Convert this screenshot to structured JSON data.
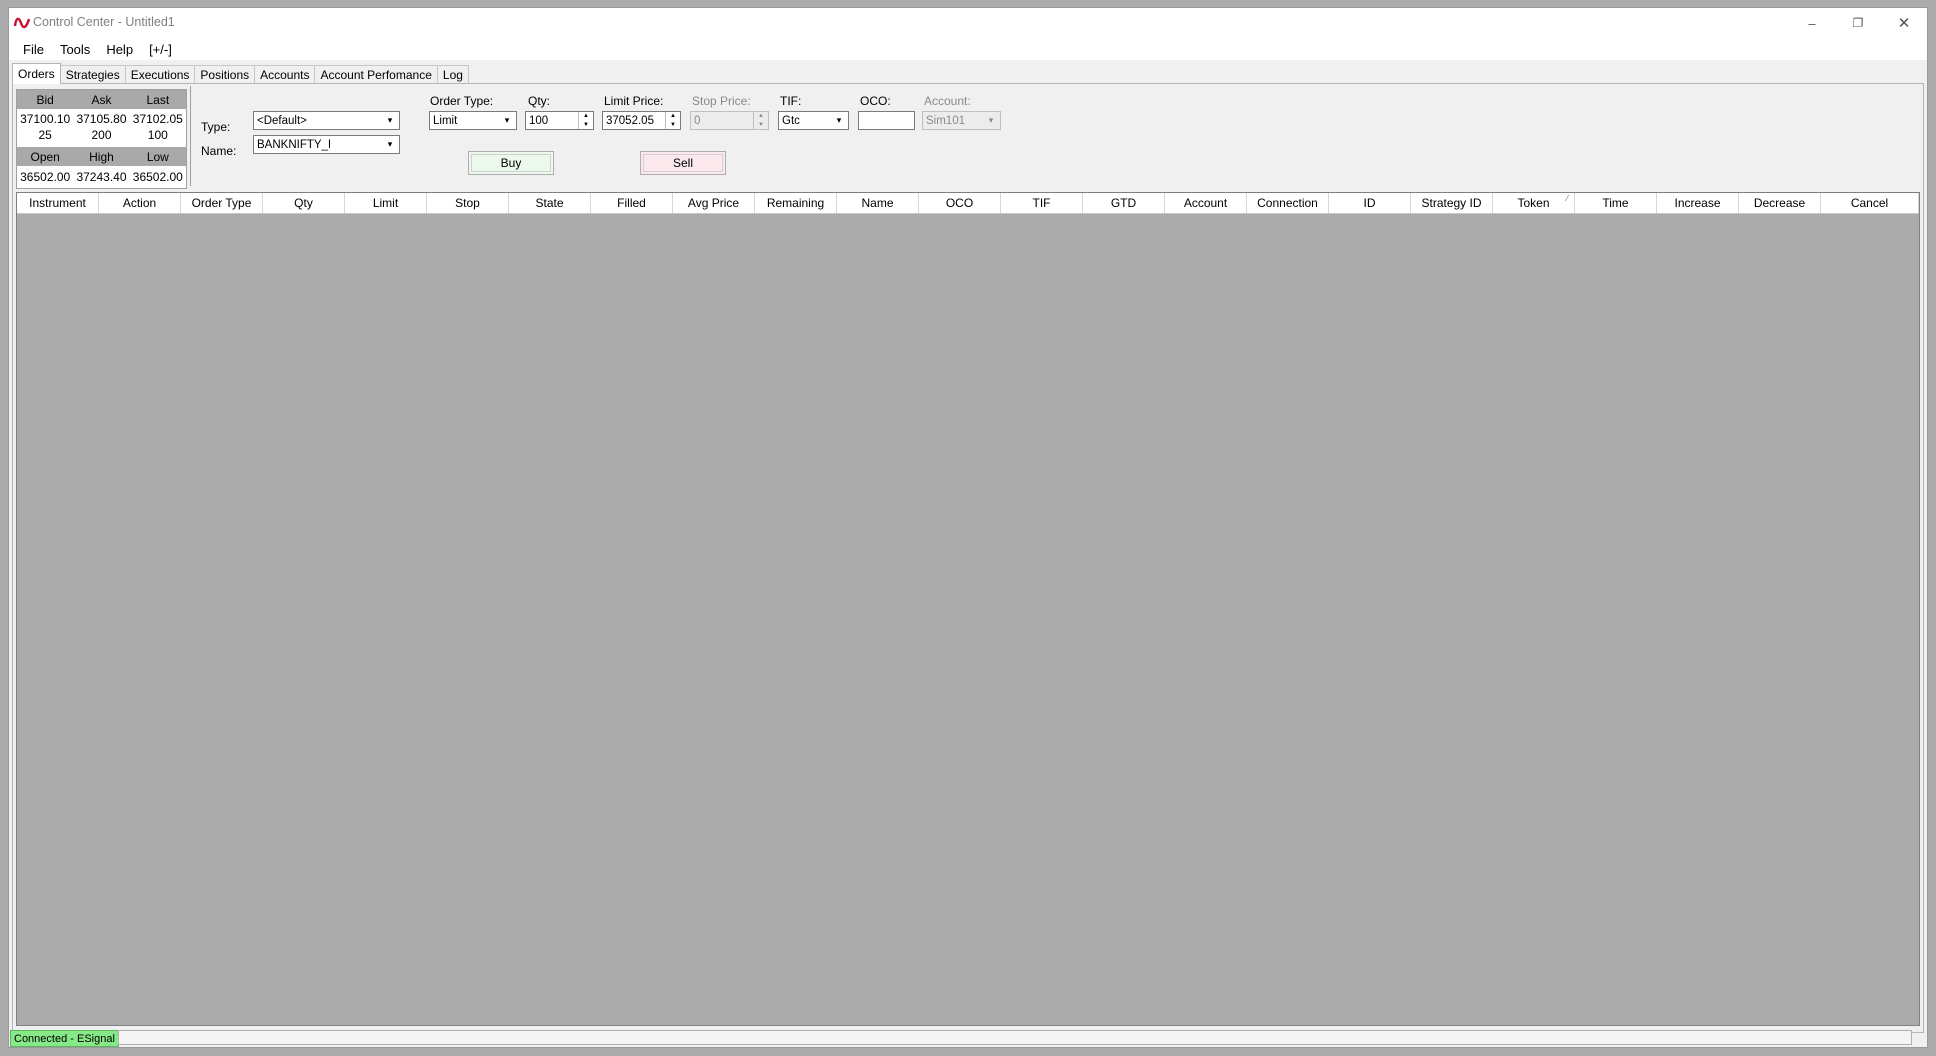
{
  "window": {
    "title": "Control Center - Untitled1",
    "controls": {
      "minimize": "–",
      "restore": "❐",
      "close": "✕"
    }
  },
  "menu": [
    "File",
    "Tools",
    "Help",
    "[+/-]"
  ],
  "tabs": [
    "Orders",
    "Strategies",
    "Executions",
    "Positions",
    "Accounts",
    "Account Perfomance",
    "Log"
  ],
  "quote": {
    "headers1": [
      "Bid",
      "Ask",
      "Last"
    ],
    "prices": [
      "37100.10",
      "37105.80",
      "37102.05"
    ],
    "sizes": [
      "25",
      "200",
      "100"
    ],
    "headers2": [
      "Open",
      "High",
      "Low"
    ],
    "ohl": [
      "36502.00",
      "37243.40",
      "36502.00"
    ]
  },
  "entry": {
    "type_label": "Type:",
    "type_value": "<Default>",
    "name_label": "Name:",
    "name_value": "BANKNIFTY_I",
    "order_type_label": "Order Type:",
    "order_type_value": "Limit",
    "qty_label": "Qty:",
    "qty_value": "100",
    "limit_label": "Limit Price:",
    "limit_value": "37052.05",
    "stop_label": "Stop Price:",
    "stop_value": "0",
    "tif_label": "TIF:",
    "tif_value": "Gtc",
    "oco_label": "OCO:",
    "oco_value": "",
    "account_label": "Account:",
    "account_value": "Sim101",
    "buy_label": "Buy",
    "sell_label": "Sell",
    "buy_color": "#eef9ee",
    "sell_color": "#fbe9ee"
  },
  "grid": {
    "columns": [
      "Instrument",
      "Action",
      "Order Type",
      "Qty",
      "Limit",
      "Stop",
      "State",
      "Filled",
      "Avg Price",
      "Remaining",
      "Name",
      "OCO",
      "TIF",
      "GTD",
      "Account",
      "Connection",
      "ID",
      "Strategy ID",
      "Token",
      "Time",
      "Increase",
      "Decrease",
      "Cancel"
    ]
  },
  "status": {
    "connection": "Connected - ESignal",
    "connection_color": "#86e886"
  }
}
